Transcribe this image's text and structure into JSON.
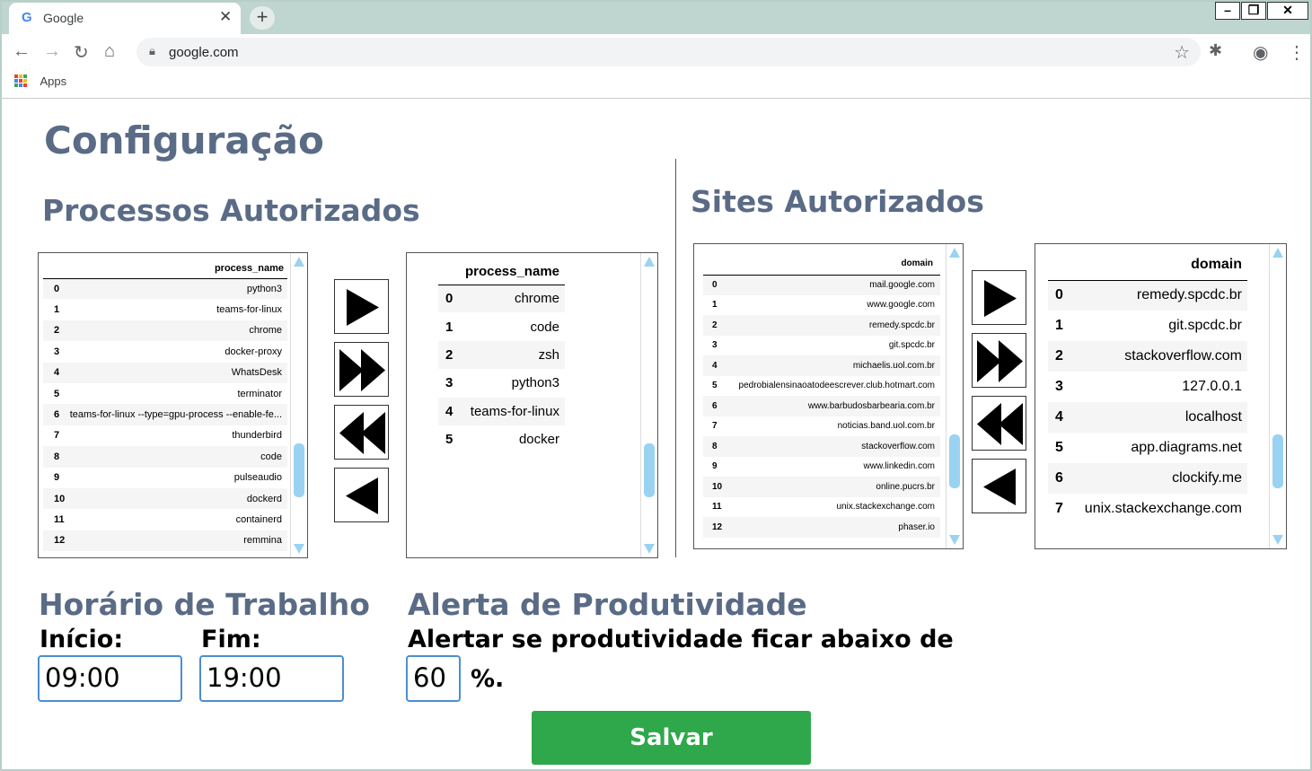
{
  "browser": {
    "tab_title": "Google",
    "tab_favicon": "G",
    "url": "google.com",
    "bookmark_apps": "Apps",
    "icons": [
      "back-icon",
      "forward-icon",
      "reload-icon",
      "home-icon",
      "lock-icon",
      "star-icon",
      "extensions-icon",
      "account-icon",
      "menu-icon"
    ]
  },
  "page": {
    "title": "Configuração",
    "processes": {
      "heading": "Processos Autorizados",
      "left_table": {
        "header": "process_name",
        "rows": [
          [
            "0",
            "python3"
          ],
          [
            "1",
            "teams-for-linux"
          ],
          [
            "2",
            "chrome"
          ],
          [
            "3",
            "docker-proxy"
          ],
          [
            "4",
            "WhatsDesk"
          ],
          [
            "5",
            "terminator"
          ],
          [
            "6",
            "teams-for-linux --type=gpu-process --enable-fe..."
          ],
          [
            "7",
            "thunderbird"
          ],
          [
            "8",
            "code"
          ],
          [
            "9",
            "pulseaudio"
          ],
          [
            "10",
            "dockerd"
          ],
          [
            "11",
            "containerd"
          ],
          [
            "12",
            "remmina"
          ]
        ]
      },
      "right_table": {
        "header": "process_name",
        "rows": [
          [
            "0",
            "chrome"
          ],
          [
            "1",
            "code"
          ],
          [
            "2",
            "zsh"
          ],
          [
            "3",
            "python3"
          ],
          [
            "4",
            "teams-for-linux"
          ],
          [
            "5",
            "docker"
          ]
        ]
      }
    },
    "sites": {
      "heading": "Sites Autorizados",
      "left_table": {
        "header": "domain",
        "rows": [
          [
            "0",
            "mail.google.com"
          ],
          [
            "1",
            "www.google.com"
          ],
          [
            "2",
            "remedy.spcdc.br"
          ],
          [
            "3",
            "git.spcdc.br"
          ],
          [
            "4",
            "michaelis.uol.com.br"
          ],
          [
            "5",
            "pedrobialensinaoatodeescrever.club.hotmart.com"
          ],
          [
            "6",
            "www.barbudosbarbearia.com.br"
          ],
          [
            "7",
            "noticias.band.uol.com.br"
          ],
          [
            "8",
            "stackoverflow.com"
          ],
          [
            "9",
            "www.linkedin.com"
          ],
          [
            "10",
            "online.pucrs.br"
          ],
          [
            "11",
            "unix.stackexchange.com"
          ],
          [
            "12",
            "phaser.io"
          ]
        ]
      },
      "right_table": {
        "header": "domain",
        "rows": [
          [
            "0",
            "remedy.spcdc.br"
          ],
          [
            "1",
            "git.spcdc.br"
          ],
          [
            "2",
            "stackoverflow.com"
          ],
          [
            "3",
            "127.0.0.1"
          ],
          [
            "4",
            "localhost"
          ],
          [
            "5",
            "app.diagrams.net"
          ],
          [
            "6",
            "clockify.me"
          ],
          [
            "7",
            "unix.stackexchange.com"
          ]
        ]
      }
    },
    "work_hours": {
      "heading": "Horário de Trabalho",
      "start_label": "Início:",
      "start_value": "09:00",
      "end_label": "Fim:",
      "end_value": "19:00"
    },
    "productivity": {
      "heading": "Alerta de Produtividade",
      "text": "Alertar se produtividade ficar abaixo de",
      "value": "60",
      "suffix": "%."
    },
    "save_label": "Salvar"
  }
}
